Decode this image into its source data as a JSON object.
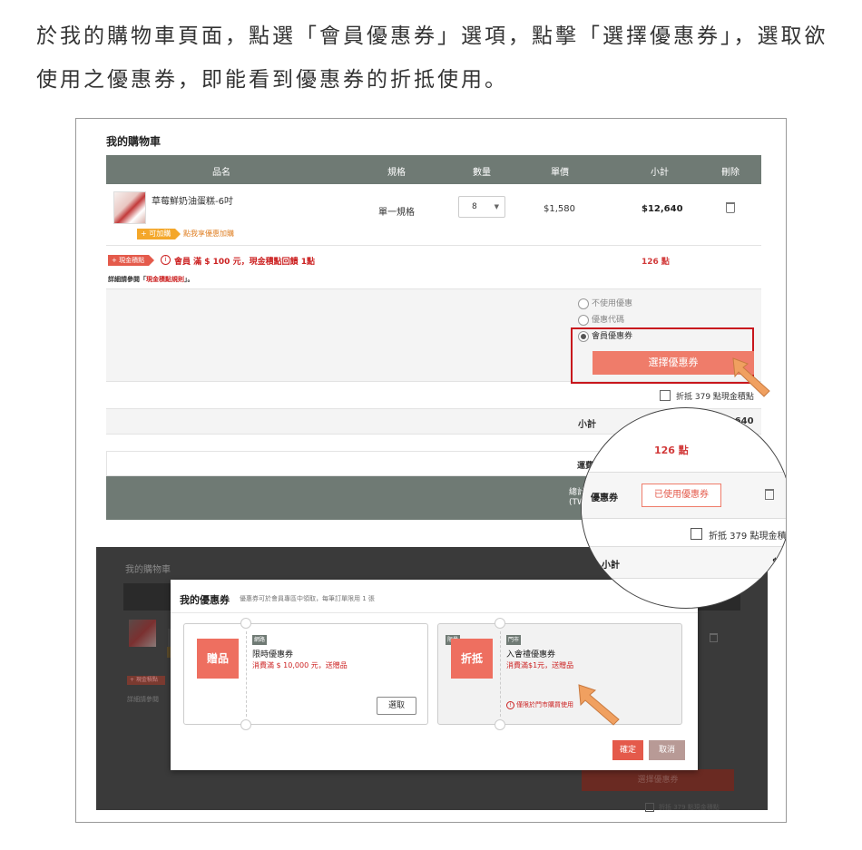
{
  "intro_text": "於我的購物車頁面，點選「會員優惠券」選項，點擊「選擇優惠券」，選取欲使用之優惠券，即能看到優惠券的折抵使用。",
  "cart": {
    "title": "我的購物車",
    "headers": {
      "name": "品名",
      "spec": "規格",
      "qty": "數量",
      "price": "單價",
      "subtotal": "小計",
      "delete": "刪除"
    },
    "product": {
      "name": "草莓鮮奶油蛋糕-6吋",
      "addon_tag": "+ 可加購",
      "addon_link": "點我享優惠加購",
      "spec": "單一規格",
      "qty": "8",
      "qty_caret": "▼",
      "price": "$1,580",
      "subtotal": "$12,640"
    },
    "points": {
      "tag": "+ 現金積點",
      "info_icon": "i",
      "text": "會員 滿 $ 100 元，現金積點回饋 1點",
      "rule_prefix": "詳細請參閱「",
      "rule_link": "現金積點規則",
      "rule_suffix": "」。",
      "value": "126 點"
    },
    "coupon_options": {
      "none": "不使用優惠",
      "code": "優惠代碼",
      "member": "會員優惠券",
      "choose_button": "選擇優惠券"
    },
    "deduct_label": "折抵 379 點現金積點",
    "subtotal_label": "小計",
    "subtotal_value": "$12,640",
    "shipping_label": "運費",
    "total_label": "總計",
    "total_sub": "(TWD)"
  },
  "magnifier": {
    "points_value": "126 點",
    "coupon_label": "優惠券",
    "used_coupon_button": "已使用優惠券",
    "deduct_label": "折抵 379 點現金積點",
    "subtotal_label": "小計",
    "subtotal_value": "$1"
  },
  "lower": {
    "cart_title": "我的購物車",
    "points_tag": "+ 現金積點",
    "rule_text": "詳細請參閱",
    "choose_button": "選擇優惠券",
    "deduct_label": "折抵 379 點現金積點"
  },
  "modal": {
    "title": "我的優惠券",
    "subtitle": "優惠券可於會員專區中領取，每筆訂單限用 1 張",
    "coupons": [
      {
        "badge": "贈品",
        "chips": [
          "網路"
        ],
        "name": "限時優惠券",
        "condition": "消費滿 $ 10,000 元，送贈品",
        "pick_label": "選取"
      },
      {
        "badge": "折抵",
        "chips": [
          "限量",
          "門市"
        ],
        "name": "入會禮優惠券",
        "condition": "消費滿$1元，送贈品",
        "warning": "僅限於門市購買使用"
      }
    ],
    "confirm_button": "確定",
    "cancel_button": "取消"
  },
  "colors": {
    "accent": "#ef7c6a",
    "header": "#6f7a74",
    "highlight": "#c8161d",
    "cursor": "#f0a060"
  }
}
